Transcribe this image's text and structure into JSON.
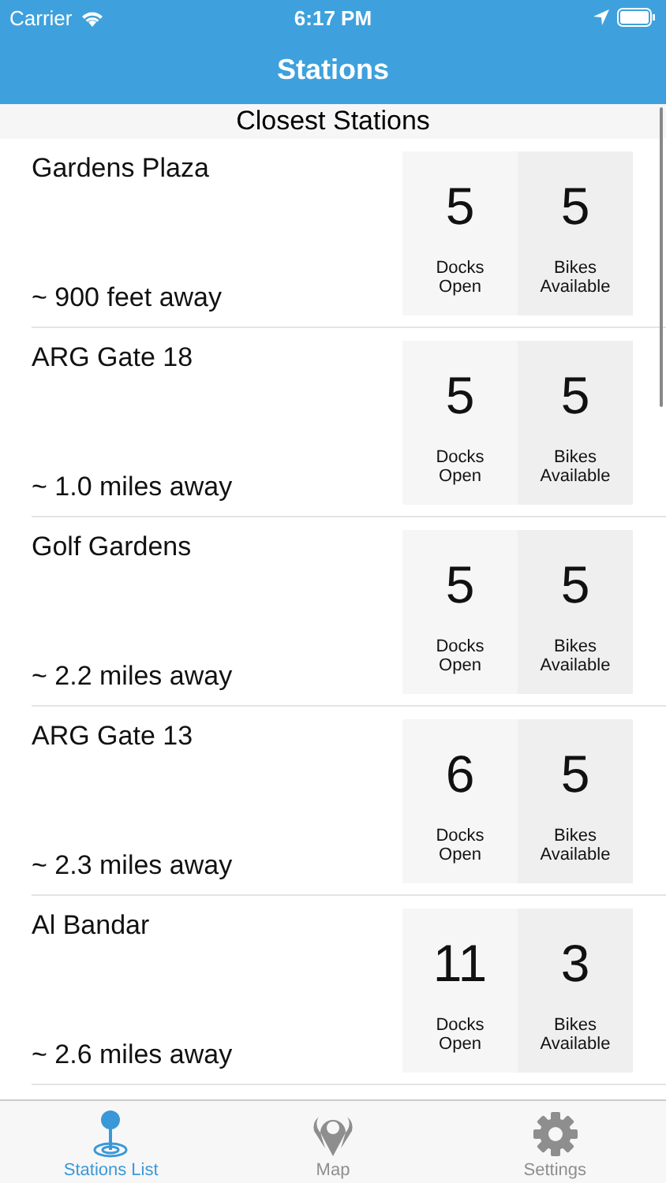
{
  "status_bar": {
    "carrier": "Carrier",
    "time": "6:17 PM"
  },
  "nav_bar": {
    "title": "Stations"
  },
  "section_header": "Closest Stations",
  "stations": [
    {
      "name": "Gardens Plaza",
      "distance": "~ 900 feet away",
      "docks": "5",
      "docks_label": "Docks Open",
      "bikes": "5",
      "bikes_label": "Bikes Available"
    },
    {
      "name": "ARG Gate 18",
      "distance": "~ 1.0 miles away",
      "docks": "5",
      "docks_label": "Docks Open",
      "bikes": "5",
      "bikes_label": "Bikes Available"
    },
    {
      "name": "Golf Gardens",
      "distance": "~ 2.2 miles away",
      "docks": "5",
      "docks_label": "Docks Open",
      "bikes": "5",
      "bikes_label": "Bikes Available"
    },
    {
      "name": "ARG Gate 13",
      "distance": "~ 2.3 miles away",
      "docks": "6",
      "docks_label": "Docks Open",
      "bikes": "5",
      "bikes_label": "Bikes Available"
    },
    {
      "name": "Al Bandar",
      "distance": "~ 2.6 miles away",
      "docks": "11",
      "docks_label": "Docks Open",
      "bikes": "3",
      "bikes_label": "Bikes Available"
    }
  ],
  "tab_bar": [
    {
      "kind": "pin",
      "label": "Stations List",
      "selected": true
    },
    {
      "kind": "map",
      "label": "Map",
      "selected": false
    },
    {
      "kind": "gear",
      "label": "Settings",
      "selected": false
    }
  ]
}
